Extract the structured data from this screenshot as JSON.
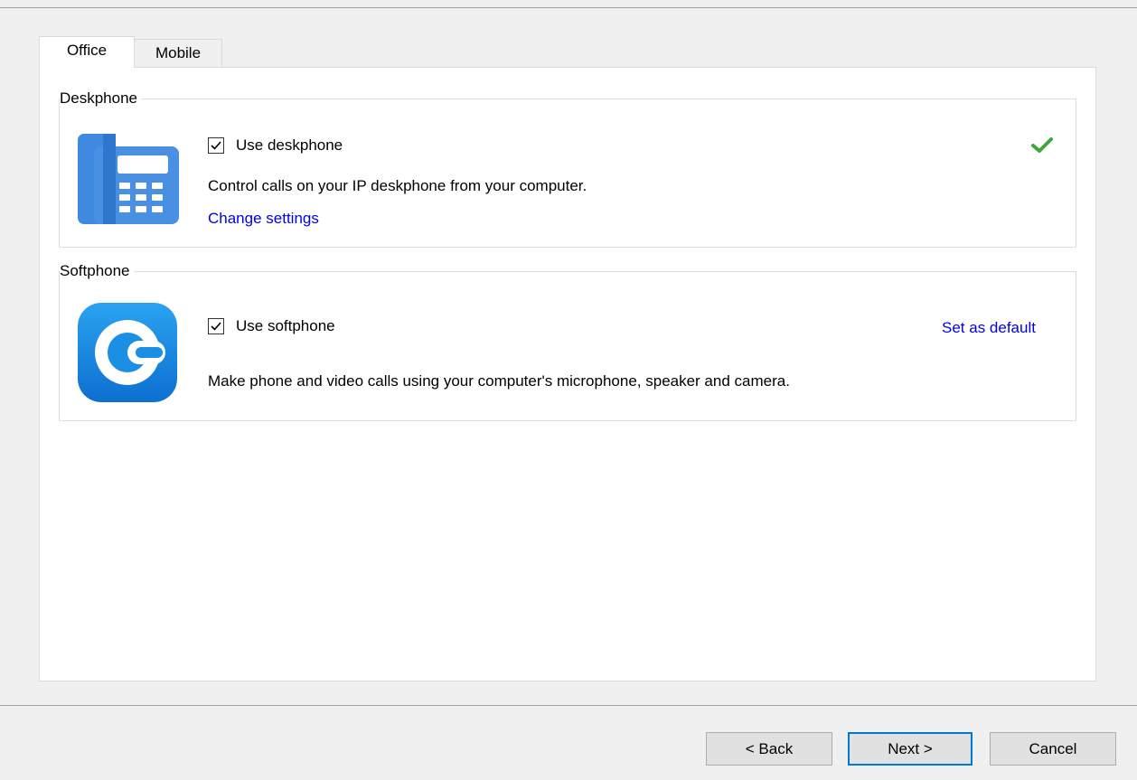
{
  "tabs": [
    {
      "label": "Office",
      "selected": true
    },
    {
      "label": "Mobile",
      "selected": false
    }
  ],
  "deskphone": {
    "group_title": "Deskphone",
    "checkbox_label": "Use deskphone",
    "checked": true,
    "description": "Control calls on your IP deskphone from your computer.",
    "link_label": "Change settings",
    "status_icon": "checkmark-icon",
    "icon": "deskphone-icon"
  },
  "softphone": {
    "group_title": "Softphone",
    "checkbox_label": "Use softphone",
    "checked": true,
    "description": "Make phone and video calls using your computer's microphone, speaker and camera.",
    "link_label": "Set as default",
    "icon": "softphone-icon"
  },
  "footer": {
    "back_label": "< Back",
    "next_label": "Next >",
    "cancel_label": "Cancel"
  },
  "colors": {
    "link": "#0000ee",
    "accent": "#0078d7",
    "deskphone_icon": "#3f8ae0",
    "softphone_icon": "#1a8fe3",
    "status_ok": "#3fa63f"
  }
}
